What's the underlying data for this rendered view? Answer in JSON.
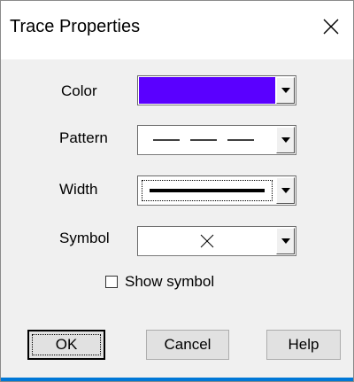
{
  "window": {
    "title": "Trace Properties",
    "close_icon": "close-icon"
  },
  "form": {
    "color_label": "Color",
    "pattern_label": "Pattern",
    "width_label": "Width",
    "symbol_label": "Symbol",
    "selected_color": "#5a00ff",
    "pattern_value": "dashed",
    "width_value": "thick",
    "symbol_value": "x",
    "show_symbol_label": "Show symbol",
    "show_symbol_checked": false
  },
  "buttons": {
    "ok": "OK",
    "cancel": "Cancel",
    "help": "Help"
  }
}
